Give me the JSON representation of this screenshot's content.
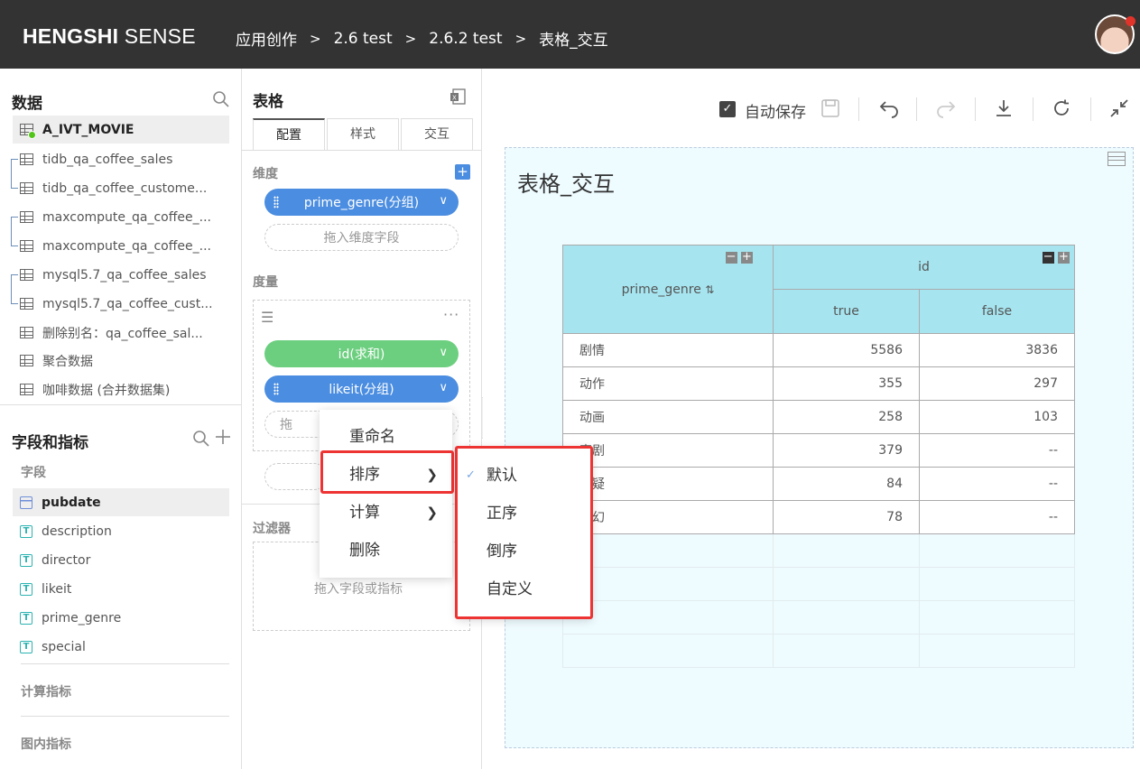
{
  "app": {
    "logo_bold": "HENGSHI",
    "logo_rest": " SENSE"
  },
  "breadcrumb": [
    "应用创作",
    "2.6 test",
    "2.6.2 test",
    "表格_交互"
  ],
  "breadcrumb_sep": ">",
  "data_panel": {
    "title": "数据",
    "items": [
      "A_IVT_MOVIE",
      "tidb_qa_coffee_sales",
      "tidb_qa_coffee_custome...",
      "maxcompute_qa_coffee_...",
      "maxcompute_qa_coffee_...",
      "mysql5.7_qa_coffee_sales",
      "mysql5.7_qa_coffee_cust...",
      "删除别名：qa_coffee_sal...",
      "聚合数据",
      "咖啡数据 (合并数据集)"
    ]
  },
  "fields_panel": {
    "title": "字段和指标",
    "group_fields": "字段",
    "fields": [
      {
        "name": "pubdate",
        "type": "date"
      },
      {
        "name": "description",
        "type": "text"
      },
      {
        "name": "director",
        "type": "text"
      },
      {
        "name": "likeit",
        "type": "text"
      },
      {
        "name": "prime_genre",
        "type": "text"
      },
      {
        "name": "special",
        "type": "text"
      }
    ],
    "group_calc": "计算指标",
    "group_inchart": "图内指标"
  },
  "config": {
    "title": "表格",
    "tabs": [
      "配置",
      "样式",
      "交互"
    ],
    "dimension_label": "维度",
    "dimension_pill": "prime_genre(分组)",
    "dimension_drop": "拖入维度字段",
    "measure_label": "度量",
    "measure_pills": [
      "id(求和)",
      "likeit(分组)"
    ],
    "measure_drop": "拖",
    "filter_label": "过滤器",
    "filter_drop": "拖入字段或指标"
  },
  "toolbar": {
    "autosave": "自动保存"
  },
  "chart": {
    "title": "表格_交互",
    "header_left": "prime_genre",
    "header_top": "id",
    "sub_headers": [
      "true",
      "false"
    ],
    "rows": [
      [
        "剧情",
        "5586",
        "3836"
      ],
      [
        "动作",
        "355",
        "297"
      ],
      [
        "动画",
        "258",
        "103"
      ],
      [
        "喜剧",
        "379",
        "--"
      ],
      [
        "悬疑",
        "84",
        "--"
      ],
      [
        "科幻",
        "78",
        "--"
      ]
    ]
  },
  "context_menu": {
    "items": [
      "重命名",
      "排序",
      "计算",
      "删除"
    ]
  },
  "sort_menu": {
    "items": [
      "默认",
      "正序",
      "倒序",
      "自定义"
    ],
    "checked": "默认"
  },
  "icons": {
    "search": "search-icon",
    "add": "plus-icon",
    "excel": "excel-export-icon",
    "undo": "undo-icon",
    "redo": "redo-icon",
    "download": "download-icon",
    "refresh": "refresh-icon",
    "collapse": "collapse-icon"
  },
  "colors": {
    "topbar": "#333333",
    "pill_blue": "#4b8de0",
    "pill_green": "#6ccf7f",
    "header": "#a6e5f0",
    "highlight": "#e33333"
  }
}
